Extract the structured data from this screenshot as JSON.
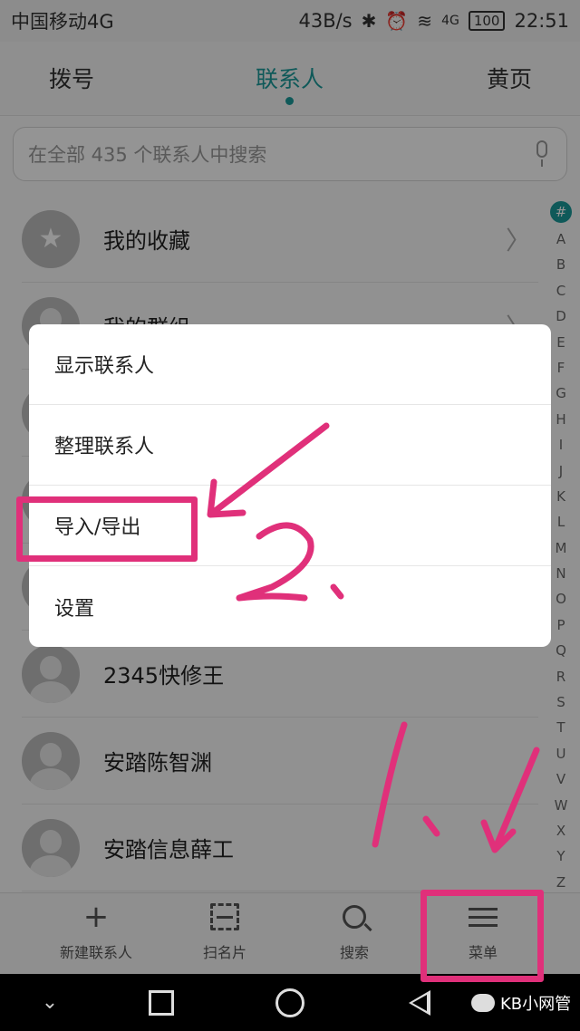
{
  "status_bar": {
    "carrier": "中国移动4G",
    "speed": "43B/s",
    "network": "4G",
    "battery": "100",
    "time": "22:51"
  },
  "tabs": [
    {
      "label": "拨号",
      "active": false
    },
    {
      "label": "联系人",
      "active": true
    },
    {
      "label": "黄页",
      "active": false
    }
  ],
  "search": {
    "placeholder": "在全部 435 个联系人中搜索"
  },
  "list": {
    "items": [
      {
        "name": "我的收藏",
        "icon": "star-icon",
        "chevron": true
      },
      {
        "name": "我的群组",
        "icon": "group-icon",
        "chevron": true
      },
      {
        "name": "",
        "icon": "avatar-icon",
        "chevron": false
      },
      {
        "name": "",
        "icon": "avatar-icon",
        "chevron": false
      },
      {
        "name": "",
        "icon": "avatar-icon",
        "chevron": false
      },
      {
        "name": "2345快修王",
        "icon": "avatar-icon",
        "chevron": false
      },
      {
        "name": "安踏陈智渊",
        "icon": "avatar-icon",
        "chevron": false
      },
      {
        "name": "安踏信息薛工",
        "icon": "avatar-icon",
        "chevron": false
      }
    ]
  },
  "index_bar": {
    "letters": [
      "#",
      "A",
      "B",
      "C",
      "D",
      "E",
      "F",
      "G",
      "H",
      "I",
      "J",
      "K",
      "L",
      "M",
      "N",
      "O",
      "P",
      "Q",
      "R",
      "S",
      "T",
      "U",
      "V",
      "W",
      "X",
      "Y",
      "Z"
    ]
  },
  "popup_menu": {
    "items": [
      {
        "label": "显示联系人"
      },
      {
        "label": "整理联系人"
      },
      {
        "label": "导入/导出"
      },
      {
        "label": "设置"
      }
    ]
  },
  "bottom_bar": {
    "items": [
      {
        "label": "新建联系人",
        "icon": "plus-icon"
      },
      {
        "label": "扫名片",
        "icon": "scan-icon"
      },
      {
        "label": "搜索",
        "icon": "search-icon"
      },
      {
        "label": "菜单",
        "icon": "menu-icon"
      }
    ]
  },
  "nav_bar": {
    "watermark": "KB小网管"
  },
  "annotations": {
    "step1": "1.",
    "step2": "2.",
    "color": "#e0307a"
  },
  "colors": {
    "accent": "#1a9a9a",
    "annotation": "#e0307a"
  }
}
